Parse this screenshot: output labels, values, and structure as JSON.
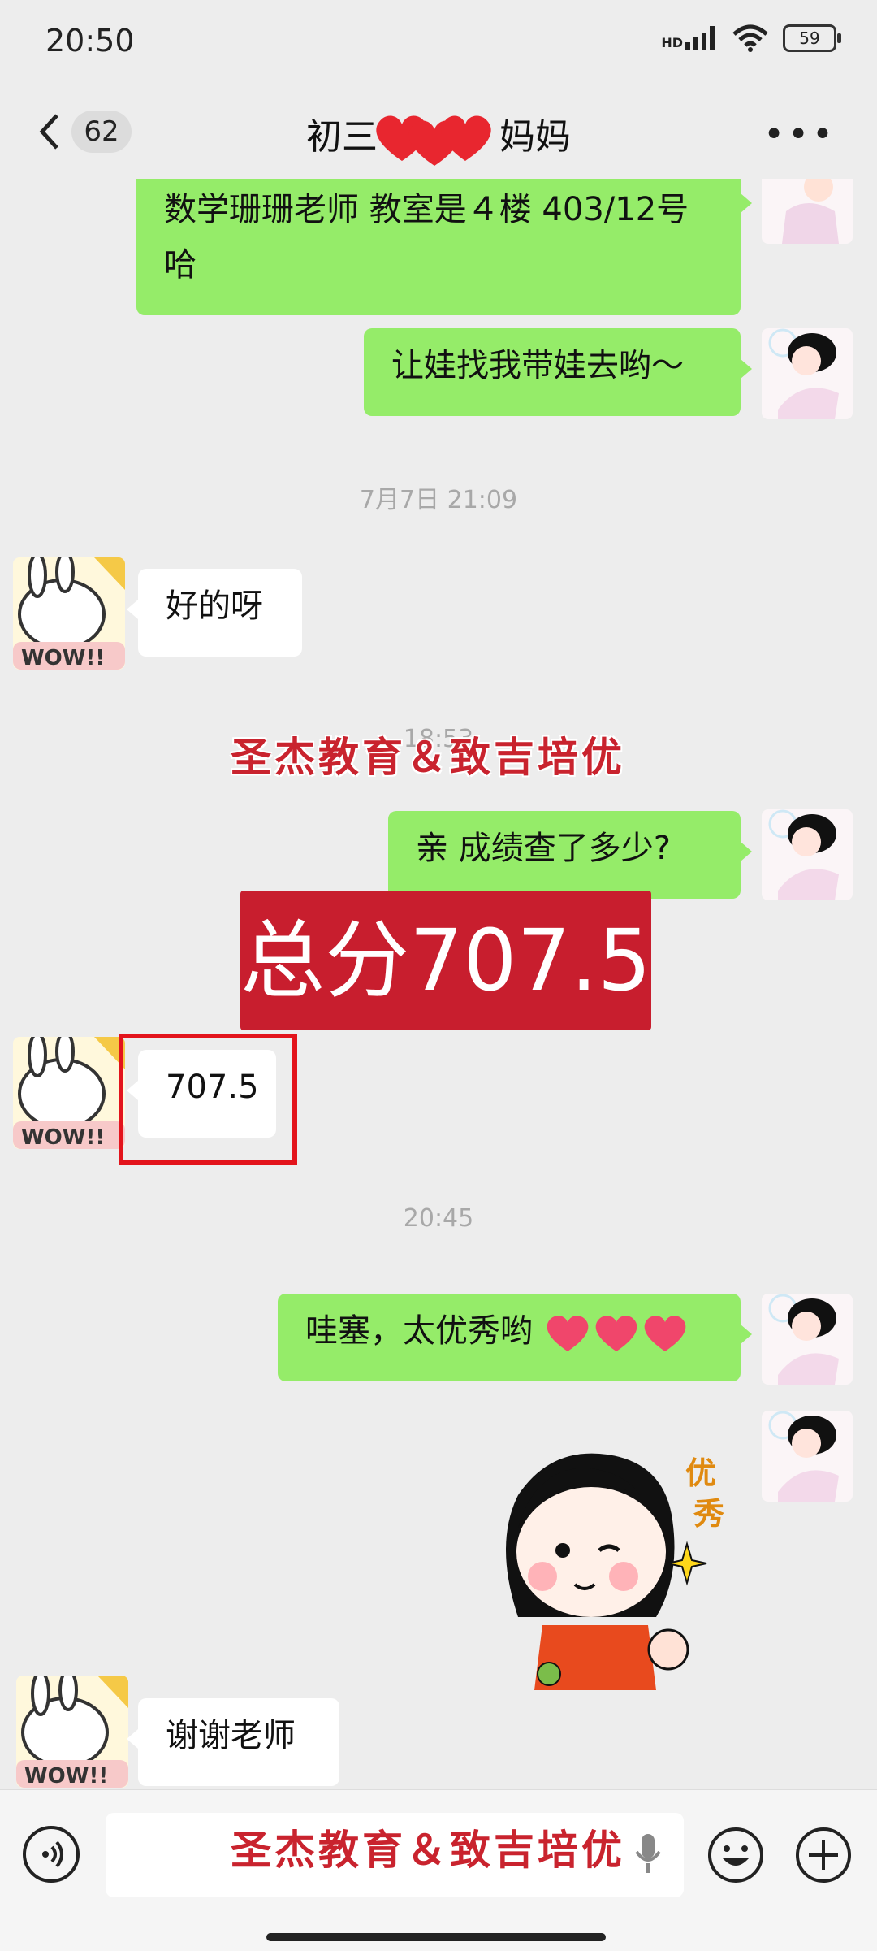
{
  "status": {
    "time": "20:50",
    "network": "HD",
    "battery": "59"
  },
  "header": {
    "unread_count": "62",
    "title_prefix": "初三",
    "title_suffix": "妈妈"
  },
  "messages": [
    {
      "id": "m1",
      "from": "me",
      "text": "数学珊珊老师  教室是４楼  403/12号哈"
    },
    {
      "id": "m2",
      "from": "me",
      "text": "让娃找我带娃去哟～"
    },
    {
      "id": "t1",
      "type": "timestamp",
      "text": "7月7日 21:09"
    },
    {
      "id": "m3",
      "from": "other",
      "text": "好的呀"
    },
    {
      "id": "t2",
      "type": "timestamp",
      "text": "18:53"
    },
    {
      "id": "m4",
      "from": "me",
      "text": "亲  成绩查了多少?"
    },
    {
      "id": "m5",
      "from": "other",
      "text": "707.5"
    },
    {
      "id": "t3",
      "type": "timestamp",
      "text": "20:45"
    },
    {
      "id": "m6",
      "from": "me",
      "text": "哇塞，太优秀哟"
    },
    {
      "id": "m7",
      "from": "me",
      "type": "sticker",
      "sticker_text": "优秀"
    },
    {
      "id": "m8",
      "from": "other",
      "text": "谢谢老师"
    }
  ],
  "overlays": {
    "watermark": "圣杰教育＆致吉培优",
    "score_banner": "总分707.5"
  },
  "colors": {
    "my_bubble": "#95ec69",
    "other_bubble": "#ffffff",
    "accent_red": "#c81e2e"
  }
}
